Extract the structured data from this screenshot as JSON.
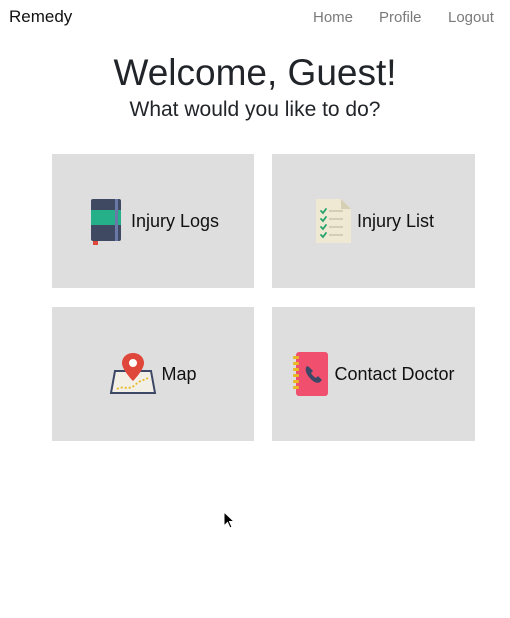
{
  "navbar": {
    "brand": "Remedy",
    "links": [
      {
        "label": "Home"
      },
      {
        "label": "Profile"
      },
      {
        "label": "Logout"
      }
    ]
  },
  "header": {
    "title": "Welcome, Guest!",
    "subtitle": "What would you like to do?"
  },
  "tiles": [
    {
      "label": "Injury Logs",
      "icon": "notebook-icon"
    },
    {
      "label": "Injury List",
      "icon": "checklist-document-icon"
    },
    {
      "label": "Map",
      "icon": "map-pin-icon"
    },
    {
      "label": "Contact Doctor",
      "icon": "phone-book-icon"
    }
  ],
  "colors": {
    "tile_background": "#dedede",
    "nav_link": "#7a7a7a",
    "text": "#212529"
  }
}
